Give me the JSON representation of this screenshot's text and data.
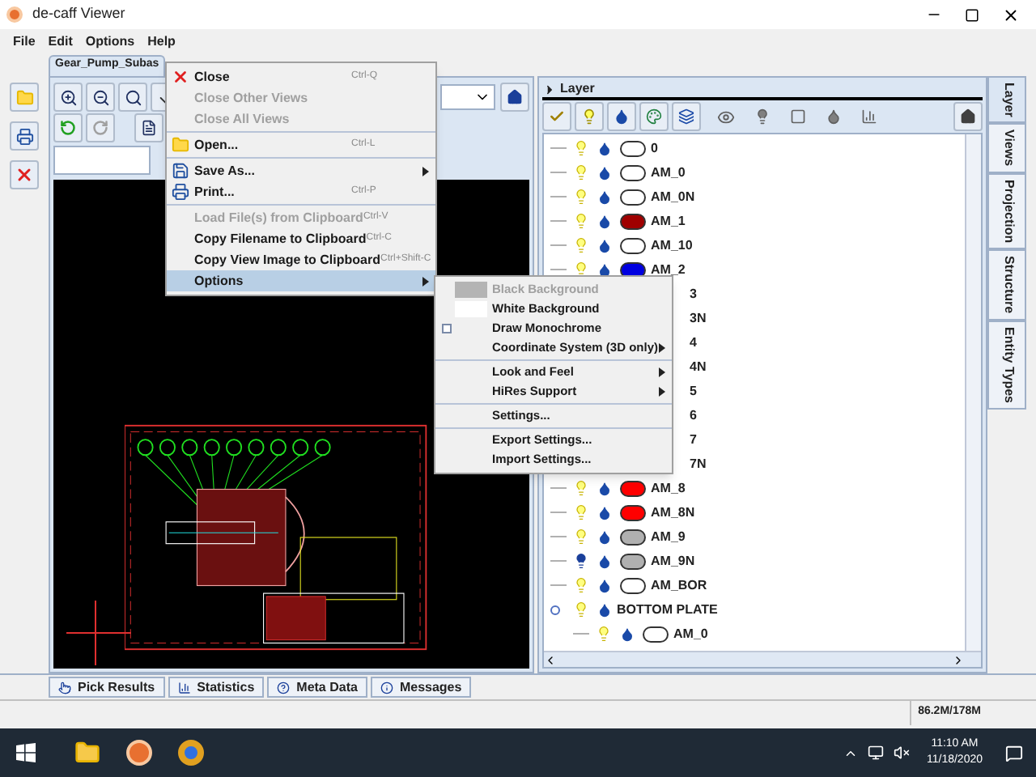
{
  "window": {
    "title": "de-caff Viewer"
  },
  "menu_bar": [
    {
      "label": "File"
    },
    {
      "label": "Edit"
    },
    {
      "label": "Options"
    },
    {
      "label": "Help"
    }
  ],
  "document_tab": {
    "label": "Gear_Pump_Subas"
  },
  "file_menu": [
    {
      "kind": "item",
      "label": "Close",
      "shortcut": "Ctrl-Q",
      "disabled": false
    },
    {
      "kind": "item",
      "label": "Close Other Views",
      "disabled": true
    },
    {
      "kind": "item",
      "label": "Close All Views",
      "disabled": true
    },
    {
      "kind": "separator"
    },
    {
      "kind": "item",
      "label": "Open...",
      "shortcut": "Ctrl-L",
      "disabled": false
    },
    {
      "kind": "separator"
    },
    {
      "kind": "submenu",
      "label": "Save As...",
      "selected": false
    },
    {
      "kind": "item",
      "label": "Print...",
      "shortcut": "Ctrl-P",
      "disabled": false
    },
    {
      "kind": "separator"
    },
    {
      "kind": "item",
      "label": "Load File(s) from Clipboard",
      "shortcut": "Ctrl-V",
      "disabled": true
    },
    {
      "kind": "item",
      "label": "Copy Filename to Clipboard",
      "shortcut": "Ctrl-C",
      "disabled": false
    },
    {
      "kind": "item",
      "label": "Copy View Image to Clipboard",
      "shortcut": "Ctrl+Shift-C",
      "disabled": false
    },
    {
      "kind": "submenu",
      "label": "Options",
      "selected": true
    }
  ],
  "options_menu": [
    {
      "kind": "swatch",
      "label": "Black Background",
      "color": "#b4b4b4",
      "disabled": true
    },
    {
      "kind": "swatch",
      "label": "White Background",
      "color": "#ffffff",
      "disabled": false
    },
    {
      "kind": "checkbox",
      "label": "Draw Monochrome",
      "checked": false
    },
    {
      "kind": "submenu",
      "label": "Coordinate System (3D only)"
    },
    {
      "kind": "separator"
    },
    {
      "kind": "submenu",
      "label": "Look and Feel"
    },
    {
      "kind": "submenu",
      "label": "HiRes Support"
    },
    {
      "kind": "separator"
    },
    {
      "kind": "item",
      "label": "Settings..."
    },
    {
      "kind": "separator"
    },
    {
      "kind": "item",
      "label": "Export Settings..."
    },
    {
      "kind": "item",
      "label": "Import Settings..."
    }
  ],
  "layer_panel": {
    "title": "Layer",
    "layers": [
      {
        "kind": "layer",
        "label": "0",
        "visible": true,
        "color": "#ffffff"
      },
      {
        "kind": "layer",
        "label": "AM_0",
        "visible": true,
        "color": "#ffffff"
      },
      {
        "kind": "layer",
        "label": "AM_0N",
        "visible": true,
        "color": "#ffffff"
      },
      {
        "kind": "layer",
        "label": "AM_1",
        "visible": true,
        "color": "#a00000"
      },
      {
        "kind": "layer",
        "label": "AM_10",
        "visible": true,
        "color": "#ffffff"
      },
      {
        "kind": "layer",
        "label": "AM_2",
        "visible": true,
        "color": "#0000e0"
      },
      {
        "kind": "covered",
        "label": "3"
      },
      {
        "kind": "covered",
        "label": "3N"
      },
      {
        "kind": "covered",
        "label": "4"
      },
      {
        "kind": "covered",
        "label": "4N"
      },
      {
        "kind": "covered",
        "label": "5"
      },
      {
        "kind": "covered",
        "label": "6"
      },
      {
        "kind": "covered",
        "label": "7"
      },
      {
        "kind": "covered",
        "label": "7N"
      },
      {
        "kind": "layer",
        "label": "AM_8",
        "visible": true,
        "color": "#ff0000"
      },
      {
        "kind": "layer",
        "label": "AM_8N",
        "visible": true,
        "color": "#ff0000"
      },
      {
        "kind": "layer",
        "label": "AM_9",
        "visible": true,
        "color": "#b0b0b0"
      },
      {
        "kind": "layer",
        "label": "AM_9N",
        "visible": false,
        "color": "#b0b0b0"
      },
      {
        "kind": "layer",
        "label": "AM_BOR",
        "visible": true,
        "color": "#ffffff"
      },
      {
        "kind": "group",
        "label": "BOTTOM PLATE",
        "visible": true,
        "expanded": true,
        "children": [
          {
            "kind": "layer",
            "label": "AM_0",
            "visible": true,
            "color": "#ffffff"
          }
        ]
      }
    ]
  },
  "side_tabs": [
    {
      "label": "Layer",
      "selected": true
    },
    {
      "label": "Views",
      "selected": false
    },
    {
      "label": "Projection",
      "selected": false
    },
    {
      "label": "Structure",
      "selected": false
    },
    {
      "label": "Entity Types",
      "selected": false
    }
  ],
  "bottom_tabs": [
    {
      "label": "Pick Results"
    },
    {
      "label": "Statistics"
    },
    {
      "label": "Meta Data"
    },
    {
      "label": "Messages"
    }
  ],
  "status_bar": {
    "memory": "86.2M/178M"
  },
  "taskbar": {
    "time": "11:10 AM",
    "date": "11/18/2020"
  }
}
